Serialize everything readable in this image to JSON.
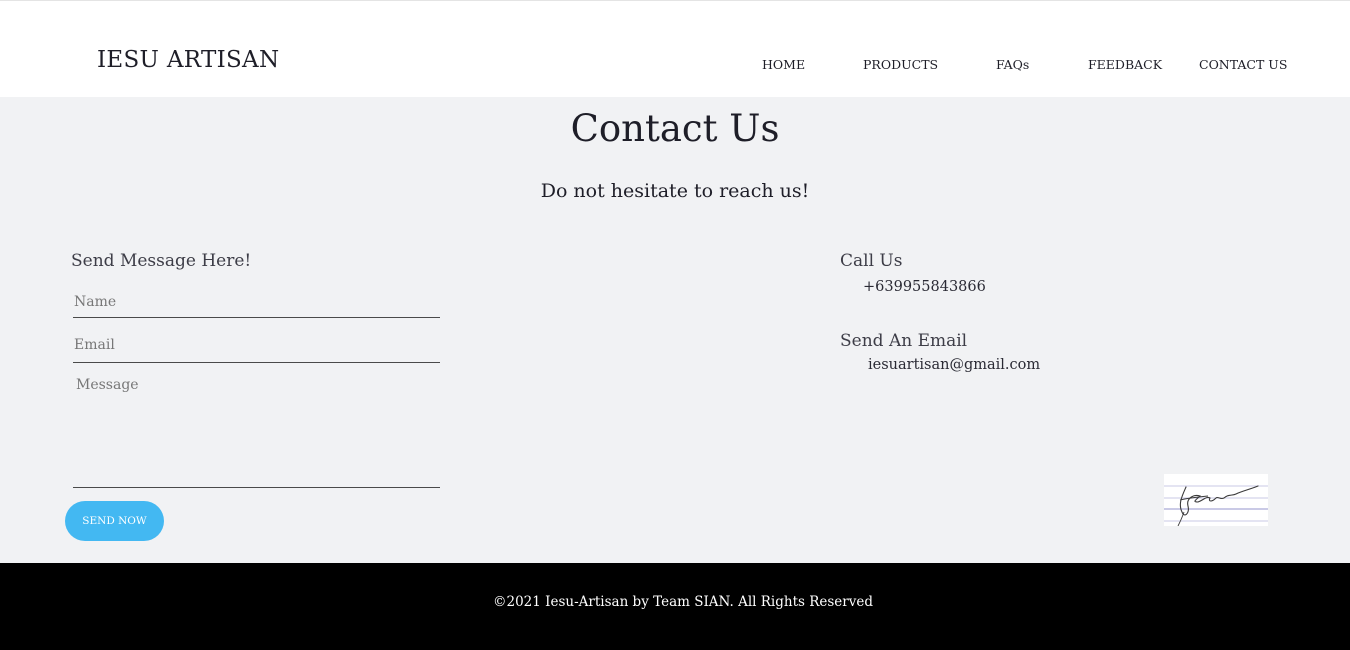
{
  "header": {
    "brand": "IESU ARTISAN",
    "nav": [
      {
        "label": "HOME"
      },
      {
        "label": "PRODUCTS"
      },
      {
        "label": "FAQs"
      },
      {
        "label": "FEEDBACK"
      },
      {
        "label": "CONTACT US"
      }
    ]
  },
  "main": {
    "title": "Contact Us",
    "subtitle": "Do not hesitate to reach us!",
    "form": {
      "heading": "Send Message Here!",
      "name_placeholder": "Name",
      "email_placeholder": "Email",
      "message_placeholder": "Message",
      "send_label": "SEND NOW"
    },
    "call": {
      "heading": "Call Us",
      "phone": "+639955843866"
    },
    "email": {
      "heading": "Send An Email",
      "address": "iesuartisan@gmail.com"
    }
  },
  "footer": {
    "text": "©2021 Iesu-Artisan by Team SIAN. All Rights Reserved"
  },
  "colors": {
    "accent_button": "#43b8f2",
    "main_background": "#f1f2f4",
    "footer_background": "#000000"
  }
}
